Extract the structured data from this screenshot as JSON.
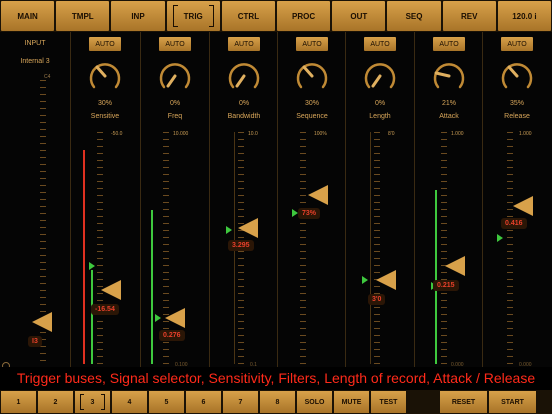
{
  "top_tabs": [
    {
      "label": "MAIN",
      "selected": false
    },
    {
      "label": "TMPL",
      "selected": false
    },
    {
      "label": "INP",
      "selected": false
    },
    {
      "label": "TRIG",
      "selected": true
    },
    {
      "label": "CTRL",
      "selected": false
    },
    {
      "label": "PROC",
      "selected": false
    },
    {
      "label": "OUT",
      "selected": false
    },
    {
      "label": "SEQ",
      "selected": false
    },
    {
      "label": "REV",
      "selected": false
    },
    {
      "label": "120.0 i",
      "selected": false
    }
  ],
  "input": {
    "label": "INPUT",
    "source": "Internal 3",
    "scale_top": "C4",
    "value": "I3"
  },
  "channels": [
    {
      "auto": "AUTO",
      "percent": "30%",
      "name": "Sensitive",
      "scale_top": "-50.0",
      "value": "-16.54"
    },
    {
      "auto": "AUTO",
      "percent": "0%",
      "name": "Freq",
      "scale_top": "10.000",
      "scale_bottom": "0.100",
      "value": "0.276"
    },
    {
      "auto": "AUTO",
      "percent": "0%",
      "name": "Bandwidth",
      "scale_top": "10.0",
      "scale_bottom": "0.1",
      "value": "3.295"
    },
    {
      "auto": "AUTO",
      "percent": "30%",
      "name": "Sequence",
      "scale_top": "100%",
      "value": "73%"
    },
    {
      "auto": "AUTO",
      "percent": "0%",
      "name": "Length",
      "scale_top": "8'0",
      "value": "3'0"
    },
    {
      "auto": "AUTO",
      "percent": "21%",
      "name": "Attack",
      "scale_top": "1.000",
      "scale_bottom": "0.000",
      "value": "0.215"
    },
    {
      "auto": "AUTO",
      "percent": "35%",
      "name": "Release",
      "scale_top": "1.000",
      "scale_bottom": "0.000",
      "value": "0.416"
    }
  ],
  "caption": "Trigger buses, Signal selector, Sensitivity, Filters, Length of record, Attack / Release",
  "bottom_buttons": [
    {
      "label": "1",
      "selected": false
    },
    {
      "label": "2",
      "selected": false
    },
    {
      "label": "3",
      "selected": true
    },
    {
      "label": "4",
      "selected": false
    },
    {
      "label": "5",
      "selected": false
    },
    {
      "label": "6",
      "selected": false
    },
    {
      "label": "7",
      "selected": false
    },
    {
      "label": "8",
      "selected": false
    },
    {
      "label": "SOLO",
      "selected": false
    },
    {
      "label": "MUTE",
      "selected": false
    },
    {
      "label": "TEST",
      "selected": false
    },
    {
      "label": "RESET",
      "selected": false
    },
    {
      "label": "START",
      "selected": false
    }
  ],
  "colors": {
    "accent": "#d8a14a",
    "value_text": "#e8402a",
    "meter_green": "#3ec83e",
    "meter_red": "#e03020",
    "caption_text": "#ff2a1a"
  }
}
